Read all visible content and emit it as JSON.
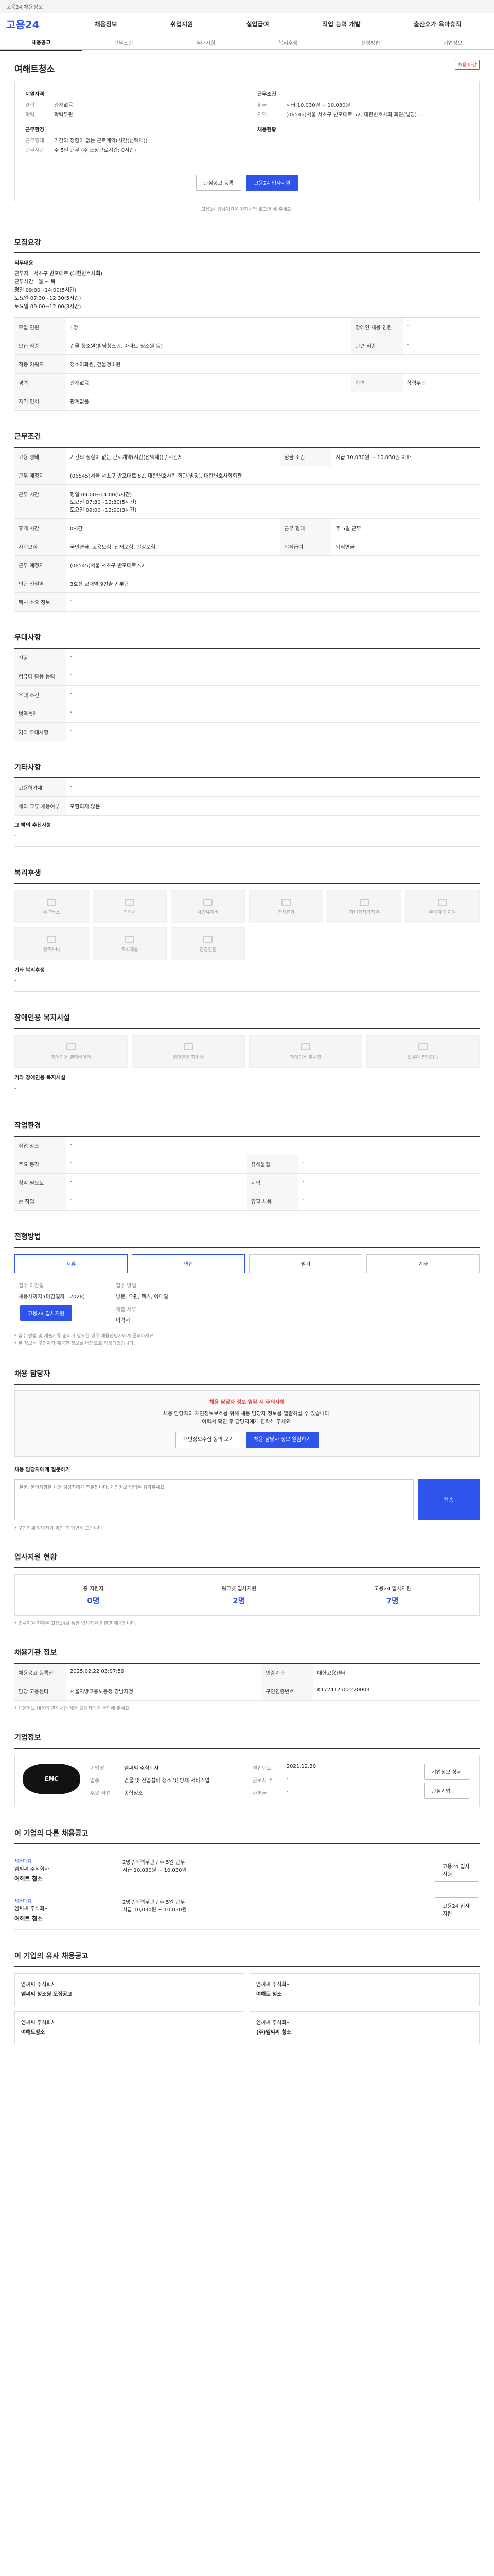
{
  "notice": {
    "pill": "",
    "text": "고용24 채용정보"
  },
  "header": {
    "logo": "고용24",
    "nav": [
      "채용정보",
      "취업지원",
      "실업급여",
      "직업 능력 개발",
      "출산휴가 육아휴직"
    ]
  },
  "tabs": [
    "채용공고",
    "근무조건",
    "우대사항",
    "복리후생",
    "전형방법",
    "기업정보"
  ],
  "job": {
    "company": "",
    "title": "여해트청소",
    "badge": "채용 마감"
  },
  "summary": {
    "left_group": "지원자격",
    "left": [
      {
        "k": "경력",
        "v": "관계없음"
      },
      {
        "k": "학력",
        "v": "학력무관"
      }
    ],
    "left_group2": "근무환경",
    "left2": [
      {
        "k": "근무형태",
        "v": "기간의 정함이 없는 근로계약(시간(선택제))"
      },
      {
        "k": "근무시간",
        "v": "주 5일 근무 (주 소정근로시간: 0시간)"
      }
    ],
    "right_group": "근무조건",
    "right": [
      {
        "k": "임금",
        "v": "시급 10,030원 ~ 10,030원"
      },
      {
        "k": "지역",
        "v": "(06545)서울 서초구 반포대로 52, 대한변호사회 회관(빌딩) ..."
      }
    ],
    "right_group2": "채용현황"
  },
  "actions": {
    "favorite": "관심공고 등록",
    "apply": "고용24 입사지원",
    "note": "고용24 입사지원을 원하시면 로그인 해 주세요."
  },
  "sec_recruit": {
    "title": "모집요강",
    "job_desc_label": "직무내용",
    "job_desc": "근무지 : 서초구 반포대로 (대한변호사회)\n근무시간 : 월 ~ 목\n평일 09:00~14:00(5시간)\n토요일 07:30~12:30(5시간)\n토요일 09:00~12:00(3시간)",
    "rows": [
      {
        "h": "모집 인원",
        "v": "1명",
        "h2": "장애인 채용 인원",
        "v2": "-"
      },
      {
        "h": "모집 직종",
        "v": "건물 청소원(빌딩청소원, 아파트 청소원 등)",
        "h2": "관련 직종",
        "v2": "-"
      },
      {
        "h": "직종 키워드",
        "v": "청소미화원, 건물청소원",
        "h2": "",
        "v2": ""
      },
      {
        "h": "경력",
        "v": "관계없음",
        "h2": "학력",
        "v2": "학력무관"
      },
      {
        "h": "자격 면허",
        "v": "관계없음",
        "h2": "",
        "v2": ""
      }
    ]
  },
  "sec_work": {
    "title": "근무조건",
    "rows": [
      {
        "h": "고용 형태",
        "v": "기간의 정함이 없는 근로계약(시간(선택제)) / 시간제",
        "h2": "임금 조건",
        "v2": "시급 10,030원 ~ 10,030원 이하"
      },
      {
        "h": "근무 예정지",
        "v": "(06545)서울 서초구 반포대로 52, 대한변호사회 회관(빌딩), 대한변호사회회관",
        "h2": "",
        "v2": ""
      },
      {
        "h": "근무 시간",
        "v": "평일 09:00~14:00(5시간)\n토요일 07:30~12:30(5시간)\n토요일 09:00~12:00(3시간)",
        "h2": "",
        "v2": ""
      },
      {
        "h": "휴게 시간",
        "v": "0시간",
        "h2": "근무 형태",
        "v2": "주 5일 근무"
      },
      {
        "h": "사회보험",
        "v": "국민연금, 고용보험, 산재보험, 건강보험",
        "h2": "퇴직급여",
        "v2": "퇴직연금"
      },
      {
        "h": "근무 예정지",
        "v": "(06545)서울 서초구 반포대로 52",
        "h2": "",
        "v2": ""
      },
      {
        "h": "인근 전철역",
        "v": "3호선 교대역 9번출구 부근",
        "h2": "",
        "v2": ""
      },
      {
        "h": "택시 소요 정보",
        "v": "-",
        "h2": "",
        "v2": ""
      }
    ]
  },
  "sec_pref": {
    "title": "우대사항",
    "rows": [
      {
        "h": "전공",
        "v": "-"
      },
      {
        "h": "컴퓨터 활용 능력",
        "v": "-"
      },
      {
        "h": "우대 조건",
        "v": "-"
      },
      {
        "h": "병역특례",
        "v": "-"
      },
      {
        "h": "기타 우대사항",
        "v": "-"
      }
    ]
  },
  "sec_etc": {
    "title": "기타사항",
    "rows": [
      {
        "h": "고용허가제",
        "v": "-"
      },
      {
        "h": "해외 교류 채용여부",
        "v": "포함되지 않음"
      }
    ],
    "extra_label": "그 밖의 추진사항",
    "extra_value": "-"
  },
  "sec_welfare": {
    "title": "복리후생",
    "items": [
      "통근버스",
      "기숙사",
      "차량유지비",
      "연차휴가",
      "자녀학자금지원",
      "주택자금 지원",
      "경조사비",
      "조식제공",
      "건강검진"
    ],
    "other_label": "기타 복리후생",
    "other_value": "-"
  },
  "sec_disabled": {
    "title": "장애인용 복지시설",
    "items": [
      "장애인용 엘리베이터",
      "장애인용 화장실",
      "장애인용 주차장",
      "휠체어 진입가능"
    ],
    "other_label": "기타 장애인용 복지시설",
    "other_value": "-"
  },
  "sec_env": {
    "title": "작업환경",
    "rows": [
      {
        "h": "작업 장소",
        "v": "-",
        "h2": "",
        "v2": ""
      },
      {
        "h": "주요 동작",
        "v": "-",
        "h2": "유해물질",
        "v2": "-"
      },
      {
        "h": "청각 필요도",
        "v": "-",
        "h2": "시력",
        "v2": "-"
      },
      {
        "h": "손 작업",
        "v": "-",
        "h2": "양팔 사용",
        "v2": "-"
      }
    ]
  },
  "sec_hiring": {
    "title": "전형방법",
    "options": [
      "서류",
      "면접",
      "필기",
      "기타"
    ],
    "apply_title": "접수 마감일",
    "apply_value": "채용시까지 (마감일자 : 2028)",
    "apply_btn": "고용24 입사지원",
    "method_title": "접수 방법",
    "method_value": "방문, 우편, 팩스, 이메일",
    "doc_title": "제출 서류",
    "doc_value": "이력서",
    "notes": [
      "* 접수 방법 및 제출서류 준비가 필요한 경우 채용담당자에게 문의하세요.",
      "* 본 정보는 구인자가 제공한 정보를 바탕으로 작성되었습니다."
    ]
  },
  "sec_contact": {
    "title": "채용 담당자",
    "warn_title": "채용 담당자 정보 열람 시 주의사항",
    "warn_text": "채용 담당자의 개인정보보호를 위해 채용 담당자 정보를 열람하실 수 있습니다.\n이력서 확인 후 담당자에게 연락해 주세요.",
    "btn1": "개인정보수집 동의 보기",
    "btn2": "채용 담당자 정보 열람하기",
    "qa_label": "채용 담당자에게 질문하기",
    "qa_placeholder": "질문, 문의사항은 채용 담당자에게 전달됩니다. 개인정보 입력은 삼가주세요.",
    "qa_btn": "전송",
    "qa_notes": [
      "* 구인업체 담당자가 확인 후 답변해 드립니다."
    ]
  },
  "sec_stats": {
    "title": "입사지원 현황",
    "items": [
      {
        "label": "총 지원자",
        "value": "0명"
      },
      {
        "label": "워크넷 입사지원",
        "value": "2명"
      },
      {
        "label": "고용24 입사지원",
        "value": "7명"
      }
    ],
    "note": "* 입사지원 현황은 고용24를 통한 입사지원 현황만 제공됩니다."
  },
  "sec_info": {
    "title": "채용기관 정보",
    "rows": [
      {
        "h": "채용공고 등록일",
        "v": "2025.02.22 03:07:59",
        "h2": "인증기관",
        "v2": "대한고용센터"
      },
      {
        "h": "담당 고용센터",
        "v": "서울지방고용노동청 강남지청",
        "h2": "구인인증번호",
        "v2": "K172412502220003"
      }
    ],
    "note": "* 채용정보 내용에 관해서는 채용 담당자에게 문의해 주세요."
  },
  "sec_company": {
    "title": "기업정보",
    "logo": "EMC",
    "rows": [
      {
        "k": "기업명",
        "v": "엠씨씨 주식회사",
        "k2": "설립년도",
        "v2": "2021.12.30"
      },
      {
        "k": "업종",
        "v": "건물 및 산업설비 청소 및 방제 서비스업",
        "k2": "근로자 수",
        "v2": "-"
      },
      {
        "k": "주요 사업",
        "v": "종합청소",
        "k2": "자본금",
        "v2": "-"
      }
    ],
    "btn1": "기업정보 상세",
    "btn2": "관심기업"
  },
  "sec_recs": {
    "title": "이 기업의 다른 채용공고",
    "items": [
      {
        "tag": "채용마감",
        "company": "엠씨씨 주식회사",
        "name": "여해트 청소",
        "cond": "2명 / 학력무관 / 주 5일 근무",
        "pay": "시급 10,030원 ~ 10,030원"
      },
      {
        "tag": "채용마감",
        "company": "엠씨씨 주식회사",
        "name": "여해트 청소",
        "cond": "2명 / 학력무관 / 주 5일 근무",
        "pay": "시급 10,030원 ~ 10,030원"
      }
    ]
  },
  "sec_similar": {
    "title": "이 기업의 유사 채용공고",
    "items": [
      {
        "company": "엠씨씨 주식회사",
        "name": "엠씨씨 청소원 모집공고"
      },
      {
        "company": "엠씨씨 주식회사",
        "name": "여해트 청소"
      },
      {
        "company": "엠씨씨 주식회사",
        "name": "여해트청소"
      },
      {
        "company": "엠씨씨 주식회사",
        "name": "(주)엠씨씨 청소"
      }
    ]
  }
}
